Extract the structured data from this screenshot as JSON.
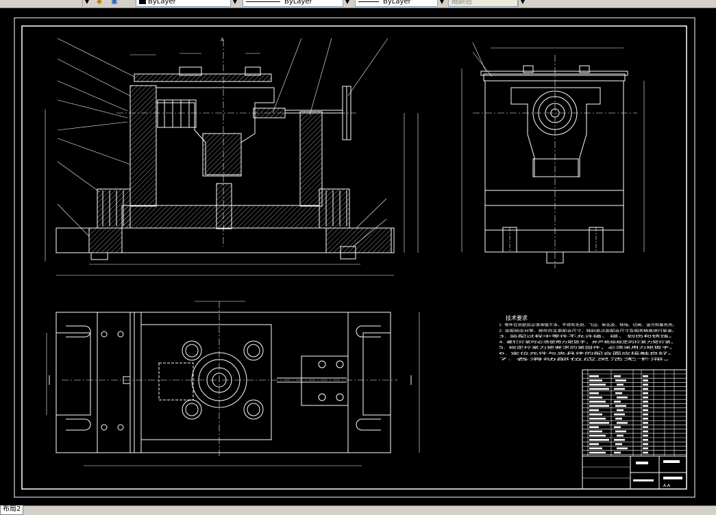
{
  "toolbar": {
    "color_value": "ByLayer",
    "linetype_value": "ByLayer",
    "lineweight_value": "ByLayer",
    "plotstyle_value": "随颜色"
  },
  "drawing": {
    "tech_title": "技术要求",
    "tech_notes": [
      "1. 零件在装配前必须清理干净，不得有毛刺、飞边、氧化皮、锈蚀、切屑、油污和着色剂。",
      "2. 装配前应对零、部件的主要配合尺寸，特别是过盈配合尺寸及相关精度进行复查。",
      "3. 装配过程中零件不允许磕、碰、划伤和锈蚀。",
      "4. 螺钉拧紧时必须使用力矩扳手，并严格按规定的拧紧力矩拧紧。",
      "5. 规定拧紧力矩要求的紧固件，必须采用力矩扳手。",
      "6. 定位元件与夹具体的配合面应接触良好。",
      "7. 各滑动部位应灵活无卡滞。"
    ],
    "section_label_a": "A",
    "section_label_b": "A-A"
  },
  "tabs": {
    "layout_tab": "布局2"
  },
  "colors": {
    "background": "#000000",
    "lines": "#ffffff",
    "toolbar": "#d4d0c8"
  }
}
